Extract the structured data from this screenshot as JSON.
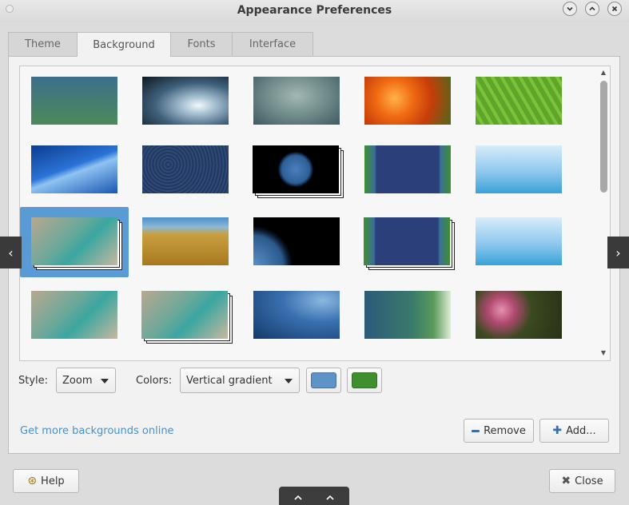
{
  "window": {
    "title": "Appearance Preferences"
  },
  "tabs": [
    {
      "label": "Theme"
    },
    {
      "label": "Background"
    },
    {
      "label": "Fonts"
    },
    {
      "label": "Interface"
    }
  ],
  "controls": {
    "style_label": "Style:",
    "style_value": "Zoom",
    "colors_label": "Colors:",
    "colors_value": "Vertical gradient",
    "primary_color": "#5d93c6",
    "secondary_color": "#3f8f2e"
  },
  "links": {
    "more_backgrounds": "Get more backgrounds online"
  },
  "buttons": {
    "remove": "Remove",
    "add": "Add...",
    "help": "Help",
    "close": "Close"
  },
  "colors": {
    "selection": "#5b9bd5",
    "link": "#4a90c8"
  }
}
